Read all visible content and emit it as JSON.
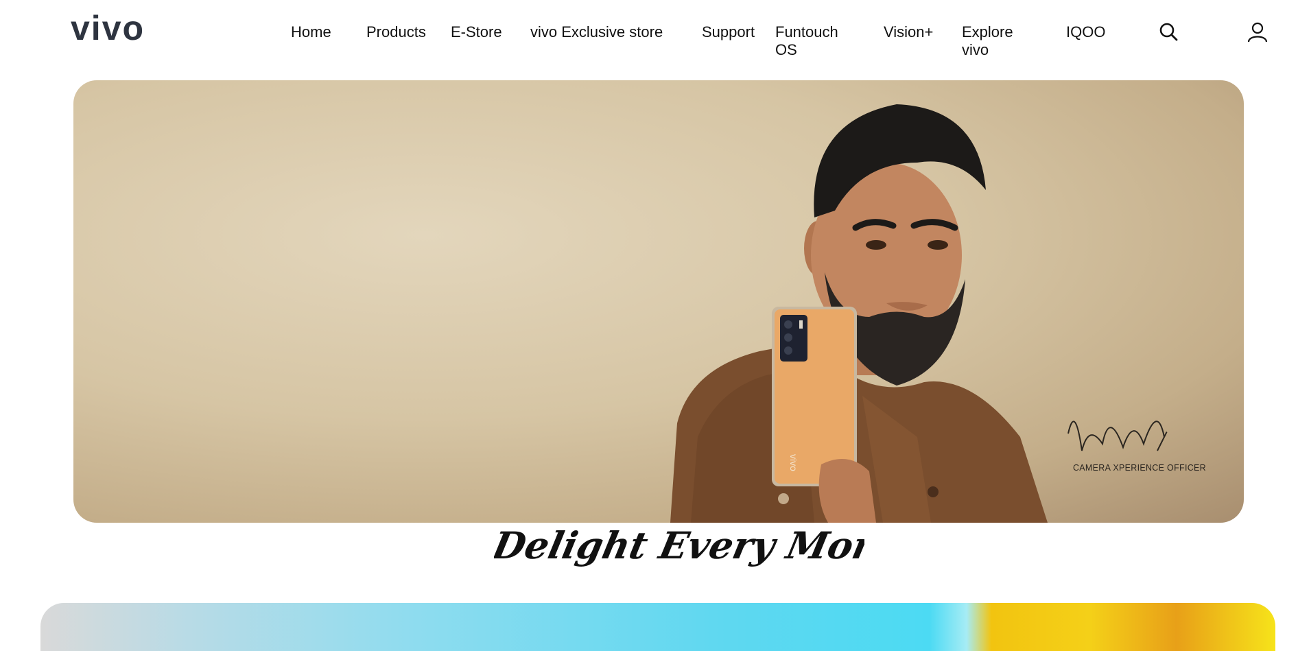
{
  "header": {
    "logo_text": "vivo",
    "nav": [
      {
        "label": "Home"
      },
      {
        "label": "Products"
      },
      {
        "label": "E-Store"
      },
      {
        "label": "vivo Exclusive store"
      },
      {
        "label": "Support"
      },
      {
        "label": "Funtouch OS"
      },
      {
        "label": "Vision+"
      },
      {
        "label": "Explore vivo"
      },
      {
        "label": "IQOO"
      }
    ],
    "icons": {
      "search": "search-icon",
      "account": "user-icon"
    }
  },
  "hero": {
    "badge_text": "CAMERA XPERIENCE OFFICER",
    "signature": "handwritten signature",
    "tagline": "Delight Every Moment",
    "phone_logo": "vivo"
  },
  "colors": {
    "logo": "#2e3440",
    "text": "#111111",
    "hero_background": "#d8c8a8",
    "jacket": "#7a4e2e",
    "phone": "#e8a566"
  }
}
